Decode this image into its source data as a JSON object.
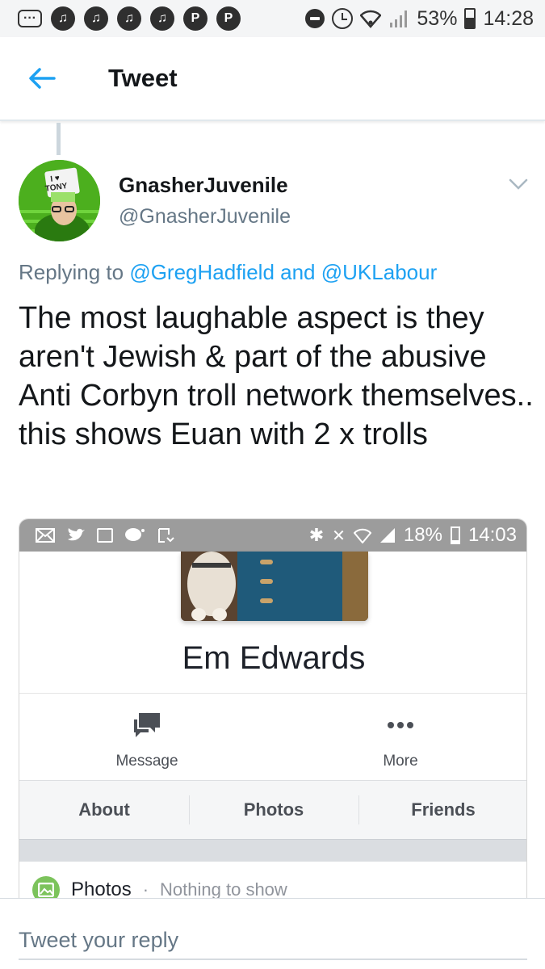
{
  "status_bar": {
    "battery": "53%",
    "time": "14:28"
  },
  "header": {
    "title": "Tweet"
  },
  "tweet": {
    "display_name": "GnasherJuvenile",
    "handle": "@GnasherJuvenile",
    "avatar_sign": "I ♥ TONY",
    "replying_prefix": "Replying to",
    "replying_user1": "@GregHadfield",
    "replying_and": "and",
    "replying_user2": "@UKLabour",
    "text": "The most laughable aspect is they aren't Jewish & part of the abusive Anti Corbyn troll network themselves.. this shows Euan with 2 x trolls"
  },
  "embedded_screenshot": {
    "status_bar": {
      "battery": "18%",
      "time": "14:03"
    },
    "profile_name": "Em Edwards",
    "actions": [
      {
        "label": "Message"
      },
      {
        "label": "More"
      }
    ],
    "tabs": [
      {
        "label": "About"
      },
      {
        "label": "Photos"
      },
      {
        "label": "Friends"
      }
    ],
    "photos_section": {
      "title": "Photos",
      "separator": "·",
      "subtitle": "Nothing to show"
    }
  },
  "reply": {
    "placeholder": "Tweet your reply"
  },
  "colors": {
    "accent": "#1da1f2",
    "text_secondary": "#657786",
    "avatar_green": "#4caf1e"
  }
}
